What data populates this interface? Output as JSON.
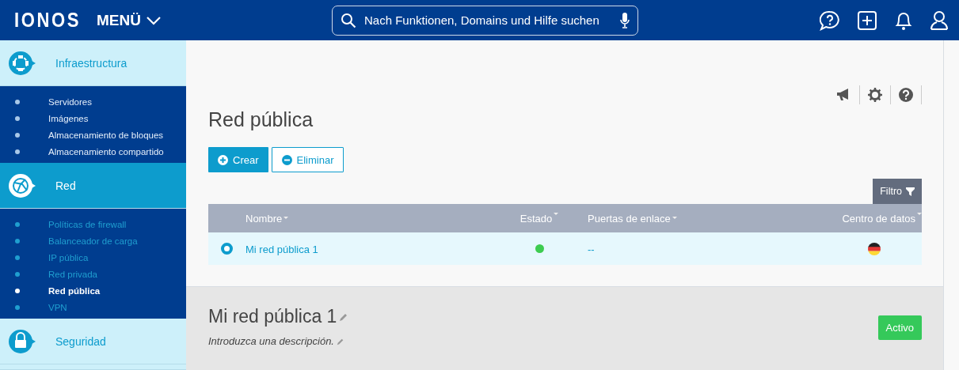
{
  "header": {
    "logo": "IONOS",
    "menu": "MENÜ",
    "search": {
      "placeholder": "Nach Funktionen, Domains und Hilfe suchen"
    }
  },
  "sidebar": {
    "sections": [
      {
        "label": "Infraestructura",
        "selected": false,
        "children": [
          {
            "label": "Servidores",
            "selected": false
          },
          {
            "label": "Imágenes",
            "selected": false
          },
          {
            "label": "Almacenamiento de bloques",
            "selected": false
          },
          {
            "label": "Almacenamiento compartido",
            "selected": false
          }
        ]
      },
      {
        "label": "Red",
        "selected": true,
        "children": [
          {
            "label": "Políticas de firewall",
            "selected": false
          },
          {
            "label": "Balanceador de carga",
            "selected": false
          },
          {
            "label": "IP pública",
            "selected": false
          },
          {
            "label": "Red privada",
            "selected": false
          },
          {
            "label": "Red pública",
            "selected": true
          },
          {
            "label": "VPN",
            "selected": false
          }
        ]
      },
      {
        "label": "Seguridad",
        "selected": false
      }
    ]
  },
  "page": {
    "title": "Red pública",
    "buttons": [
      {
        "label": "Crear",
        "kind": "primary"
      },
      {
        "label": "Eliminar",
        "kind": "secondary"
      }
    ],
    "filter": "Filtro"
  },
  "table": {
    "columns": [
      "Nombre",
      "Estado",
      "Puertas de enlace",
      "Centro de datos"
    ],
    "rows": [
      {
        "selected": true,
        "name": "Mi red pública 1",
        "color": "#3dcc50",
        "gateways": "--"
      }
    ]
  },
  "detail": {
    "title": "Mi red pública 1",
    "description": "Introduzca una descripción.",
    "status": "Activo"
  }
}
